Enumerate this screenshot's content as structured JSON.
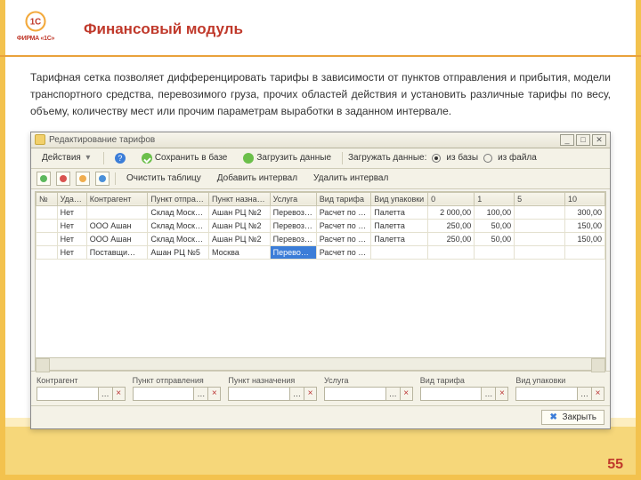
{
  "slide": {
    "title": "Финансовый модуль",
    "paragraph": "Тарифная сетка позволяет дифференцировать тарифы в зависимости от пунктов отправления и прибытия, модели транспортного средства, перевозимого груза, прочих областей действия и установить различные тарифы по весу, объему, количеству мест или прочим параметрам выработки в заданном интервале.",
    "number": "55",
    "logo_text": "ФИРМА «1С»"
  },
  "app": {
    "title": "Редактирование тарифов",
    "toolbar": {
      "actions": "Действия",
      "save": "Сохранить в базе",
      "load": "Загрузить данные",
      "load_label": "Загружать данные:",
      "from_db": "из базы",
      "from_file": "из файла"
    },
    "toolbar2": {
      "clear": "Очистить таблицу",
      "add_interval": "Добавить интервал",
      "del_interval": "Удалить интервал"
    },
    "headers": [
      "№",
      "Уда…",
      "Контрагент",
      "Пункт отпра…",
      "Пункт назна…",
      "Услуга",
      "Вид тарифа",
      "Вид упаковки",
      "0",
      "1",
      "5",
      "10"
    ],
    "col_widths": [
      "20px",
      "28px",
      "58px",
      "58px",
      "58px",
      "44px",
      "52px",
      "54px",
      "44px",
      "38px",
      "48px",
      "38px"
    ],
    "rows": [
      {
        "c": [
          "",
          "Нет",
          "",
          "Склад Моск…",
          "Ашан РЦ №2",
          "Перевоз…",
          "Расчет по …",
          "Палетта",
          "2 000,00",
          "100,00",
          "",
          "300,00"
        ]
      },
      {
        "c": [
          "",
          "Нет",
          "ООО Ашан",
          "Склад Моск…",
          "Ашан РЦ №2",
          "Перевоз…",
          "Расчет по …",
          "Палетта",
          "250,00",
          "50,00",
          "",
          "150,00"
        ]
      },
      {
        "c": [
          "",
          "Нет",
          "ООО Ашан",
          "Склад Моск…",
          "Ашан РЦ №2",
          "Перевоз…",
          "Расчет по …",
          "Палетта",
          "250,00",
          "50,00",
          "",
          "150,00"
        ]
      },
      {
        "c": [
          "",
          "Нет",
          "Поставщи…",
          "Ашан РЦ №5",
          "Москва",
          "Перево…",
          "Расчет по …",
          "",
          "",
          "",
          "",
          ""
        ],
        "sel": true,
        "sel_col": 5
      }
    ],
    "filters": [
      {
        "label": "Контрагент"
      },
      {
        "label": "Пункт отправления"
      },
      {
        "label": "Пункт назначения"
      },
      {
        "label": "Услуга"
      },
      {
        "label": "Вид тарифа"
      },
      {
        "label": "Вид упаковки"
      }
    ],
    "close": "Закрыть"
  }
}
